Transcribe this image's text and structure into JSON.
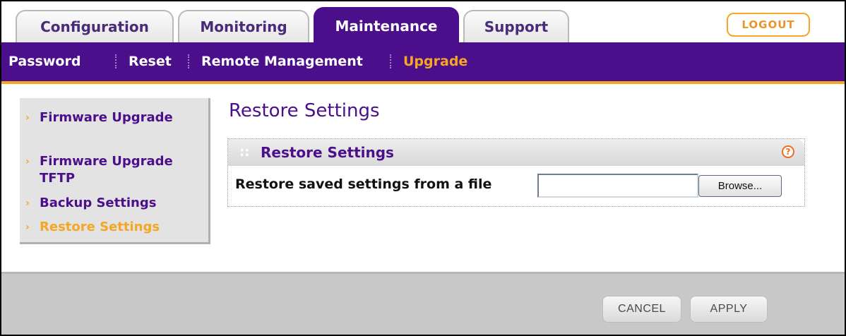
{
  "tabs": [
    {
      "label": "Configuration",
      "active": false
    },
    {
      "label": "Monitoring",
      "active": false
    },
    {
      "label": "Maintenance",
      "active": true
    },
    {
      "label": "Support",
      "active": false
    }
  ],
  "logout_label": "LOGOUT",
  "subnav": [
    {
      "label": "Password",
      "active": false
    },
    {
      "label": "Reset",
      "active": false
    },
    {
      "label": "Remote Management",
      "active": false
    },
    {
      "label": "Upgrade",
      "active": true
    }
  ],
  "sidebar": [
    {
      "label": "Firmware Upgrade",
      "active": false
    },
    {
      "label": "Firmware Upgrade TFTP",
      "active": false
    },
    {
      "label": "Backup Settings",
      "active": false
    },
    {
      "label": "Restore Settings",
      "active": true
    }
  ],
  "page_title": "Restore Settings",
  "panel": {
    "title": "Restore Settings",
    "help_glyph": "?",
    "row_label": "Restore saved settings from a file",
    "file_value": "",
    "browse_label": "Browse..."
  },
  "footer": {
    "cancel_label": "CANCEL",
    "apply_label": "APPLY"
  },
  "colors": {
    "brand_purple": "#4b0f8c",
    "accent_orange": "#f5a623"
  },
  "icons": {
    "sidebar_arrow": "chevron-right-icon",
    "panel_grip": "drag-grip-icon",
    "help": "help-icon"
  }
}
